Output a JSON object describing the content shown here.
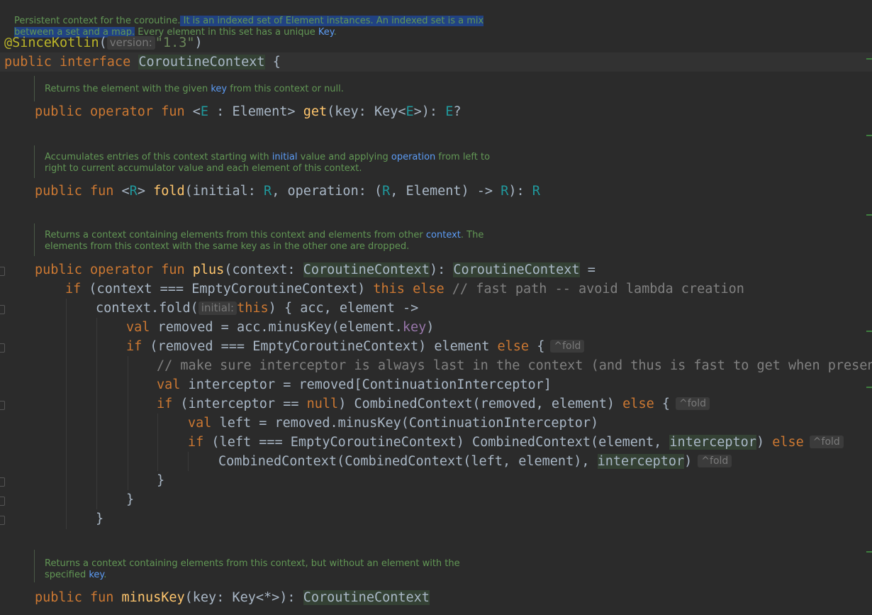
{
  "header_doc": {
    "line1_plain": "Persistent context for the coroutine.",
    "line1_sel": " It is an indexed set of Element instances. An indexed set is a mix",
    "line2_sel": "between a set and a map.",
    "line2_plain": " Every element in this set has a unique ",
    "line2_link": "Key",
    "line2_end": "."
  },
  "annotation": {
    "name": "@SinceKotlin",
    "open": "(",
    "hint": "version:",
    "value": "\"1.3\"",
    "close": ")"
  },
  "interface_decl": {
    "public": "public",
    "interface": "interface",
    "name": "CoroutineContext",
    "brace": " {"
  },
  "get_doc": {
    "pre": "Returns the element with the given ",
    "link": "key",
    "mid": " from this context or ",
    "code": "null",
    "end": "."
  },
  "get_sig": {
    "mods": "public operator fun",
    "t1": " <",
    "tp": "E",
    "t2": " : Element> ",
    "name": "get",
    "params": "(key: Key<",
    "tp2": "E",
    "params2": ">): ",
    "ret": "E",
    "q": "?"
  },
  "fold_doc": {
    "l1_pre": "Accumulates entries of this context starting with ",
    "l1_link1": "initial",
    "l1_mid": " value and applying ",
    "l1_link2": "operation",
    "l1_end": " from left to",
    "l2": "right to current accumulator value and each element of this context."
  },
  "fold_sig": {
    "mods": "public fun",
    "t1": " <",
    "tp": "R",
    "t2": "> ",
    "name": "fold",
    "p1": "(initial: ",
    "r1": "R",
    "p2": ", operation: (",
    "r2": "R",
    "p3": ", Element) -> ",
    "r3": "R",
    "p4": "): ",
    "r4": "R"
  },
  "plus_doc": {
    "l1_pre": "Returns a context containing elements from this context and elements from other ",
    "l1_link": "context",
    "l1_end": ". The",
    "l2": "elements from this context with the same key as in the other one are dropped."
  },
  "plus_sig": {
    "mods": "public operator fun",
    "name": " plus",
    "p1": "(context: ",
    "t1": "CoroutineContext",
    "p2": "): ",
    "t2": "CoroutineContext",
    "p3": " ="
  },
  "body": {
    "l1_if": "if",
    "l1_a": " (context === EmptyCoroutineContext) ",
    "l1_this": "this",
    "l1_else": " else",
    "l1_cmt": " // fast path -- avoid lambda creation",
    "l2_a": "context.fold(",
    "l2_hint": "initial:",
    "l2_this": "this",
    "l2_b": ") { acc, element ->",
    "l3_val": "val",
    "l3_a": " removed = acc.minusKey(element.",
    "l3_prop": "key",
    "l3_b": ")",
    "l4_if": "if",
    "l4_a": " (removed === EmptyCoroutineContext) element ",
    "l4_else": "else",
    "l4_b": " {",
    "l4_fold": "^fold",
    "l5_cmt": "// make sure interceptor is always last in the context (and thus is fast to get when present)",
    "l6_val": "val",
    "l6_a": " interceptor = removed[ContinuationInterceptor]",
    "l7_if": "if",
    "l7_a": " (interceptor == ",
    "l7_null": "null",
    "l7_b": ") CombinedContext(removed, element) ",
    "l7_else": "else",
    "l7_c": " {",
    "l7_fold": "^fold",
    "l8_val": "val",
    "l8_a": " left = removed.minusKey(ContinuationInterceptor)",
    "l9_if": "if",
    "l9_a": " (left === EmptyCoroutineContext) CombinedContext(element, ",
    "l9_ref": "interceptor",
    "l9_b": ") ",
    "l9_else": "else",
    "l9_fold": "^fold",
    "l10_a": "CombinedContext(CombinedContext(left, element), ",
    "l10_ref": "interceptor",
    "l10_b": ")",
    "l10_fold": "^fold",
    "close_brace": "}"
  },
  "minus_doc": {
    "l1": "Returns a context containing elements from this context, but without an element with the",
    "l2_pre": "specified ",
    "l2_link": "key",
    "l2_end": "."
  },
  "minus_sig": {
    "mods": "public fun",
    "name": " minusKey",
    "p1": "(key: Key<*>): ",
    "t1": "CoroutineContext"
  }
}
